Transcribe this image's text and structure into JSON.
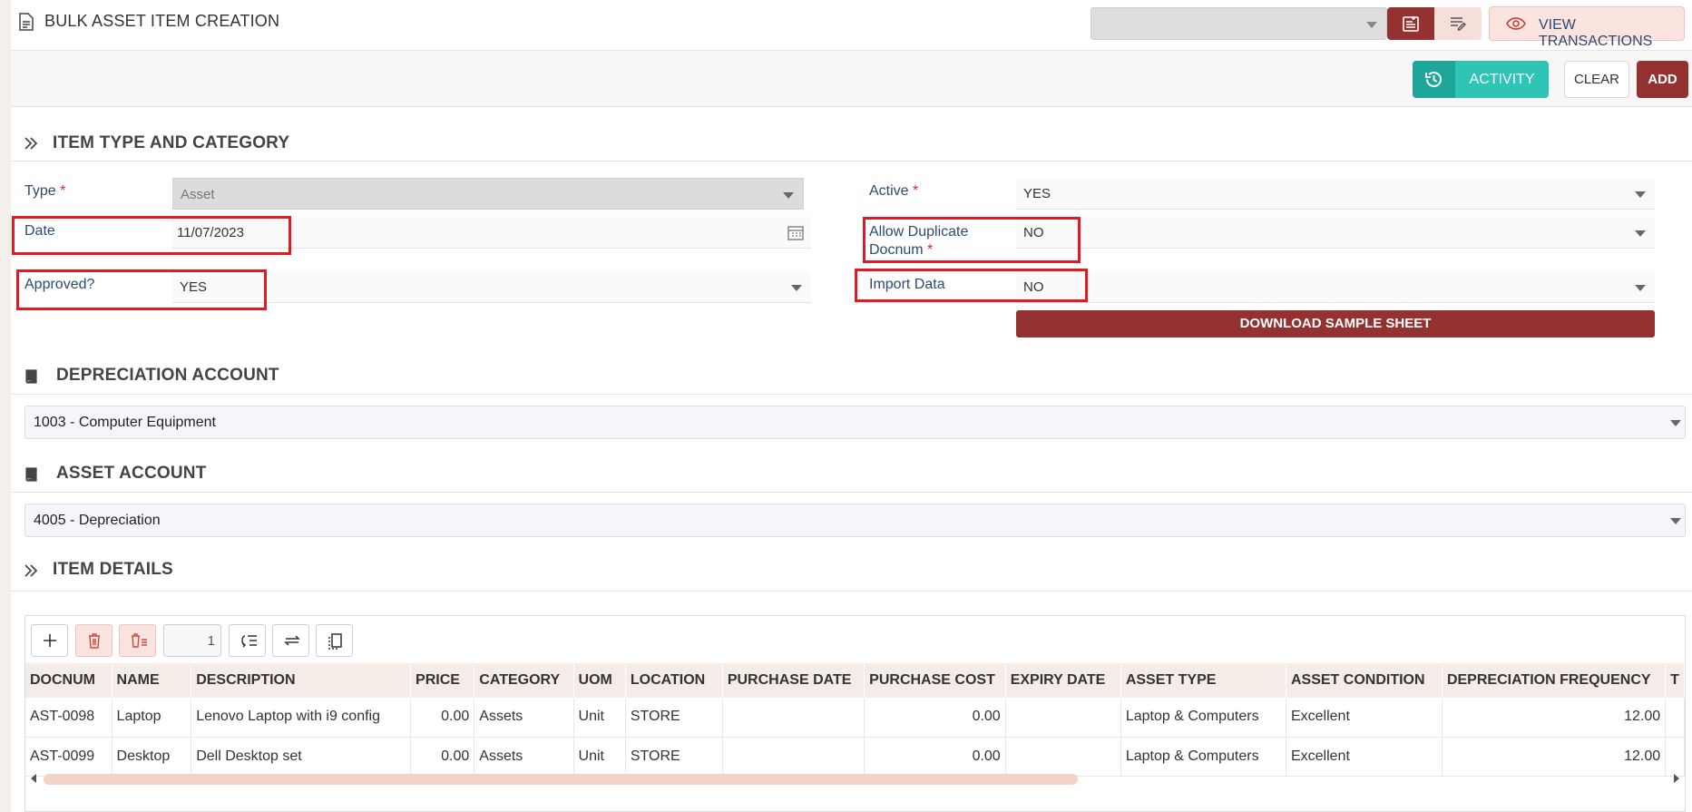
{
  "header": {
    "title": "BULK ASSET ITEM CREATION",
    "view_transactions_label": "VIEW TRANSACTIONS"
  },
  "actions": {
    "activity_label": "ACTIVITY",
    "clear_label": "CLEAR",
    "add_label": "ADD"
  },
  "sections": {
    "item_type": "ITEM TYPE AND CATEGORY",
    "depreciation": "DEPRECIATION ACCOUNT",
    "asset": "ASSET ACCOUNT",
    "item_details": "ITEM DETAILS"
  },
  "form": {
    "type": {
      "label": "Type",
      "required": "*",
      "value": "Asset"
    },
    "date": {
      "label": "Date",
      "value": "11/07/2023"
    },
    "approved": {
      "label": "Approved?",
      "value": "YES"
    },
    "active": {
      "label": "Active",
      "required": "*",
      "value": "YES"
    },
    "allow_dup": {
      "label_line1": "Allow Duplicate",
      "label_line2": "Docnum",
      "required": "*",
      "value": "NO"
    },
    "import_data": {
      "label": "Import Data",
      "value": "NO"
    },
    "download_label": "DOWNLOAD SAMPLE SHEET"
  },
  "accounts": {
    "depreciation_value": "1003 - Computer Equipment",
    "asset_value": "4005 - Depreciation"
  },
  "grid": {
    "page_number": "1",
    "columns": [
      "DOCNUM",
      "NAME",
      "DESCRIPTION",
      "PRICE",
      "CATEGORY",
      "UOM",
      "LOCATION",
      "PURCHASE DATE",
      "PURCHASE COST",
      "EXPIRY DATE",
      "ASSET TYPE",
      "ASSET CONDITION",
      "DEPRECIATION FREQUENCY",
      "T"
    ],
    "rows": [
      [
        "AST-0098",
        "Laptop",
        "Lenovo Laptop with i9 config",
        "0.00",
        "Assets",
        "Unit",
        "STORE",
        "",
        "0.00",
        "",
        "Laptop & Computers",
        "Excellent",
        "12.00",
        ""
      ],
      [
        "AST-0099",
        "Desktop",
        "Dell Desktop set",
        "0.00",
        "Assets",
        "Unit",
        "STORE",
        "",
        "0.00",
        "",
        "Laptop & Computers",
        "Excellent",
        "12.00",
        ""
      ]
    ]
  },
  "colors": {
    "primary": "#943232",
    "teal": "#2ec4b6",
    "label": "#2c4a72",
    "highlight": "#e01b24"
  }
}
